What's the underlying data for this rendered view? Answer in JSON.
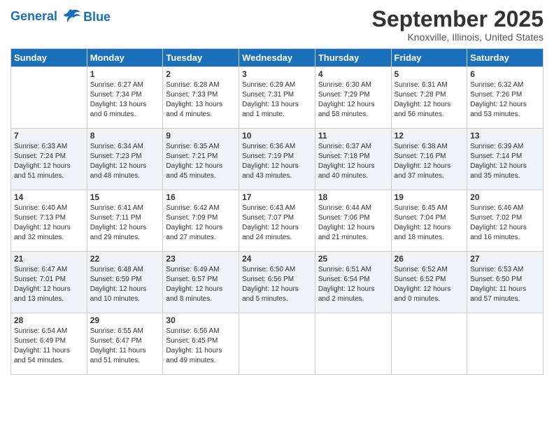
{
  "header": {
    "logo_line1": "General",
    "logo_line2": "Blue",
    "month_title": "September 2025",
    "location": "Knoxville, Illinois, United States"
  },
  "days_of_week": [
    "Sunday",
    "Monday",
    "Tuesday",
    "Wednesday",
    "Thursday",
    "Friday",
    "Saturday"
  ],
  "weeks": [
    [
      {
        "day": "",
        "content": ""
      },
      {
        "day": "1",
        "content": "Sunrise: 6:27 AM\nSunset: 7:34 PM\nDaylight: 13 hours\nand 6 minutes."
      },
      {
        "day": "2",
        "content": "Sunrise: 6:28 AM\nSunset: 7:33 PM\nDaylight: 13 hours\nand 4 minutes."
      },
      {
        "day": "3",
        "content": "Sunrise: 6:29 AM\nSunset: 7:31 PM\nDaylight: 13 hours\nand 1 minute."
      },
      {
        "day": "4",
        "content": "Sunrise: 6:30 AM\nSunset: 7:29 PM\nDaylight: 12 hours\nand 58 minutes."
      },
      {
        "day": "5",
        "content": "Sunrise: 6:31 AM\nSunset: 7:28 PM\nDaylight: 12 hours\nand 56 minutes."
      },
      {
        "day": "6",
        "content": "Sunrise: 6:32 AM\nSunset: 7:26 PM\nDaylight: 12 hours\nand 53 minutes."
      }
    ],
    [
      {
        "day": "7",
        "content": "Sunrise: 6:33 AM\nSunset: 7:24 PM\nDaylight: 12 hours\nand 51 minutes."
      },
      {
        "day": "8",
        "content": "Sunrise: 6:34 AM\nSunset: 7:23 PM\nDaylight: 12 hours\nand 48 minutes."
      },
      {
        "day": "9",
        "content": "Sunrise: 6:35 AM\nSunset: 7:21 PM\nDaylight: 12 hours\nand 45 minutes."
      },
      {
        "day": "10",
        "content": "Sunrise: 6:36 AM\nSunset: 7:19 PM\nDaylight: 12 hours\nand 43 minutes."
      },
      {
        "day": "11",
        "content": "Sunrise: 6:37 AM\nSunset: 7:18 PM\nDaylight: 12 hours\nand 40 minutes."
      },
      {
        "day": "12",
        "content": "Sunrise: 6:38 AM\nSunset: 7:16 PM\nDaylight: 12 hours\nand 37 minutes."
      },
      {
        "day": "13",
        "content": "Sunrise: 6:39 AM\nSunset: 7:14 PM\nDaylight: 12 hours\nand 35 minutes."
      }
    ],
    [
      {
        "day": "14",
        "content": "Sunrise: 6:40 AM\nSunset: 7:13 PM\nDaylight: 12 hours\nand 32 minutes."
      },
      {
        "day": "15",
        "content": "Sunrise: 6:41 AM\nSunset: 7:11 PM\nDaylight: 12 hours\nand 29 minutes."
      },
      {
        "day": "16",
        "content": "Sunrise: 6:42 AM\nSunset: 7:09 PM\nDaylight: 12 hours\nand 27 minutes."
      },
      {
        "day": "17",
        "content": "Sunrise: 6:43 AM\nSunset: 7:07 PM\nDaylight: 12 hours\nand 24 minutes."
      },
      {
        "day": "18",
        "content": "Sunrise: 6:44 AM\nSunset: 7:06 PM\nDaylight: 12 hours\nand 21 minutes."
      },
      {
        "day": "19",
        "content": "Sunrise: 6:45 AM\nSunset: 7:04 PM\nDaylight: 12 hours\nand 18 minutes."
      },
      {
        "day": "20",
        "content": "Sunrise: 6:46 AM\nSunset: 7:02 PM\nDaylight: 12 hours\nand 16 minutes."
      }
    ],
    [
      {
        "day": "21",
        "content": "Sunrise: 6:47 AM\nSunset: 7:01 PM\nDaylight: 12 hours\nand 13 minutes."
      },
      {
        "day": "22",
        "content": "Sunrise: 6:48 AM\nSunset: 6:59 PM\nDaylight: 12 hours\nand 10 minutes."
      },
      {
        "day": "23",
        "content": "Sunrise: 6:49 AM\nSunset: 6:57 PM\nDaylight: 12 hours\nand 8 minutes."
      },
      {
        "day": "24",
        "content": "Sunrise: 6:50 AM\nSunset: 6:56 PM\nDaylight: 12 hours\nand 5 minutes."
      },
      {
        "day": "25",
        "content": "Sunrise: 6:51 AM\nSunset: 6:54 PM\nDaylight: 12 hours\nand 2 minutes."
      },
      {
        "day": "26",
        "content": "Sunrise: 6:52 AM\nSunset: 6:52 PM\nDaylight: 12 hours\nand 0 minutes."
      },
      {
        "day": "27",
        "content": "Sunrise: 6:53 AM\nSunset: 6:50 PM\nDaylight: 11 hours\nand 57 minutes."
      }
    ],
    [
      {
        "day": "28",
        "content": "Sunrise: 6:54 AM\nSunset: 6:49 PM\nDaylight: 11 hours\nand 54 minutes."
      },
      {
        "day": "29",
        "content": "Sunrise: 6:55 AM\nSunset: 6:47 PM\nDaylight: 11 hours\nand 51 minutes."
      },
      {
        "day": "30",
        "content": "Sunrise: 6:56 AM\nSunset: 6:45 PM\nDaylight: 11 hours\nand 49 minutes."
      },
      {
        "day": "",
        "content": ""
      },
      {
        "day": "",
        "content": ""
      },
      {
        "day": "",
        "content": ""
      },
      {
        "day": "",
        "content": ""
      }
    ]
  ]
}
